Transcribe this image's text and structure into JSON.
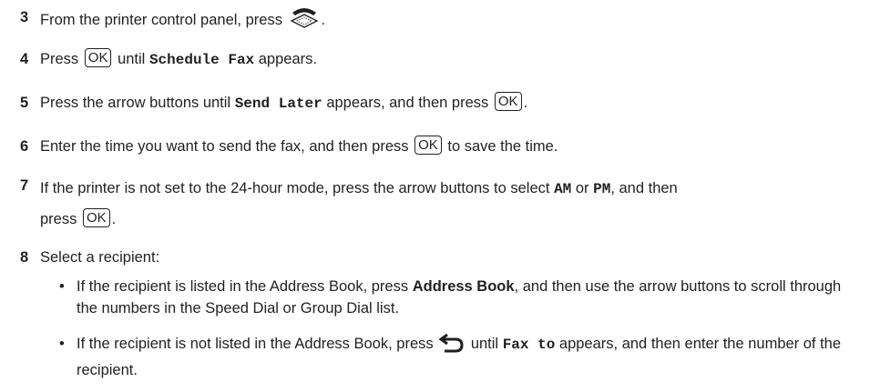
{
  "steps": {
    "s3": {
      "num": "3",
      "text_a": "From the printer control panel, press",
      "text_b": "."
    },
    "s4": {
      "num": "4",
      "text_a": "Press",
      "ok": "OK",
      "text_b": "until",
      "code": "Schedule Fax",
      "text_c": "appears."
    },
    "s5": {
      "num": "5",
      "text_a": "Press the arrow buttons until",
      "code": "Send Later",
      "text_b": "appears, and then press",
      "ok": "OK",
      "text_c": "."
    },
    "s6": {
      "num": "6",
      "text_a": "Enter the time you want to send the fax, and then press",
      "ok": "OK",
      "text_b": "to save the time."
    },
    "s7": {
      "num": "7",
      "text_a": "If the printer is not set to the 24-hour mode, press the arrow buttons to select",
      "am": "AM",
      "or": "or",
      "pm": "PM",
      "text_b": ", and then",
      "text_c": "press",
      "ok": "OK",
      "text_d": "."
    },
    "s8": {
      "num": "8",
      "text": "Select a recipient:",
      "bullet1": {
        "a": "If the recipient is listed in the Address Book, press",
        "bold": "Address Book",
        "b": ", and then use the arrow buttons to scroll through the numbers in the Speed Dial or Group Dial list."
      },
      "bullet2": {
        "a": "If the recipient is not listed in the Address Book, press",
        "b": "until",
        "code": "Fax to",
        "c": "appears, and then enter the number of the recipient."
      }
    }
  },
  "icons": {
    "fax": "fax-icon",
    "back": "back-arrow-icon"
  },
  "colors": {
    "text": "#231f20"
  }
}
